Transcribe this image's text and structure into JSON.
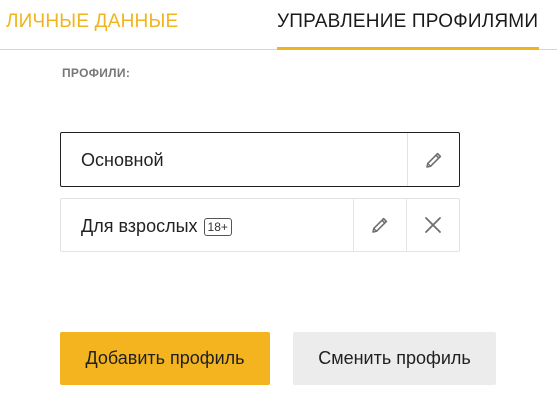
{
  "tabs": {
    "personal_label": "ЛИЧНЫЕ ДАННЫЕ",
    "profiles_label": "УПРАВЛЕНИЕ ПРОФИЛЯМИ",
    "active": "profiles"
  },
  "section_label": "ПРОФИЛИ:",
  "profiles": [
    {
      "name": "Основной",
      "active": true,
      "icons": [
        "pencil-icon"
      ]
    },
    {
      "name": "Для взрослых",
      "badge": "18+",
      "active": false,
      "icons": [
        "pencil-icon",
        "close-icon"
      ]
    }
  ],
  "buttons": {
    "add_label": "Добавить профиль",
    "switch_label": "Сменить профиль"
  },
  "colors": {
    "accent": "#f4b41f",
    "tab_inactive": "#f0b41f",
    "secondary_button": "#ececec"
  }
}
